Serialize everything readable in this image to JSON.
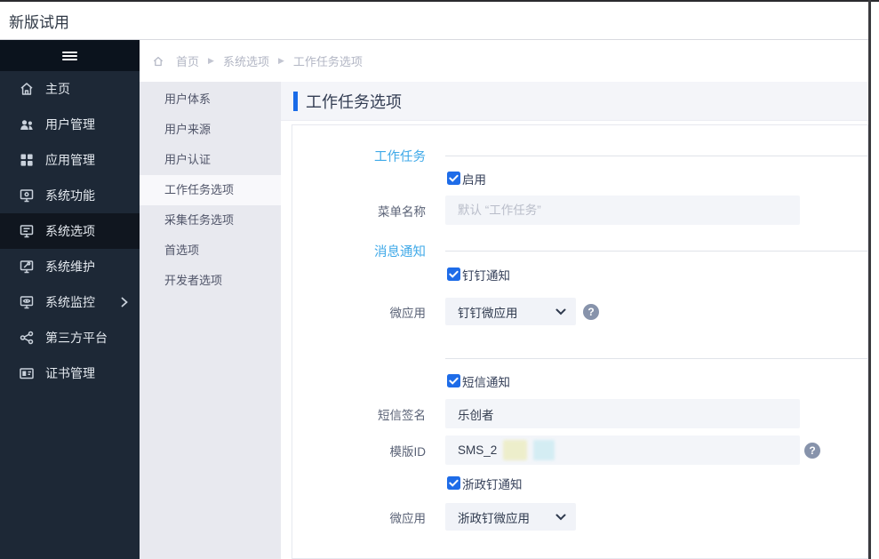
{
  "colors": {
    "accent_blue": "#1a6be8",
    "section_title_blue": "#3fa9e8",
    "checkbox_blue": "#1e6ce8",
    "sidebar_bg": "#1d2836",
    "sidebar_active_bg": "#10161f",
    "submenu_bg": "#e8e9ef",
    "titlebar_bg": "#f4f5f9",
    "input_bg": "#f3f5f9"
  },
  "header": {
    "app_title": "新版试用"
  },
  "sidebar": {
    "items": [
      {
        "label": "主页"
      },
      {
        "label": "用户管理"
      },
      {
        "label": "应用管理"
      },
      {
        "label": "系统功能"
      },
      {
        "label": "系统选项"
      },
      {
        "label": "系统维护"
      },
      {
        "label": "系统监控"
      },
      {
        "label": "第三方平台"
      },
      {
        "label": "证书管理"
      }
    ]
  },
  "breadcrumb": {
    "separator": "▶",
    "items": [
      "首页",
      "系统选项",
      "工作任务选项"
    ]
  },
  "submenu": {
    "items": [
      {
        "label": "用户体系"
      },
      {
        "label": "用户来源"
      },
      {
        "label": "用户认证"
      },
      {
        "label": "工作任务选项"
      },
      {
        "label": "采集任务选项"
      },
      {
        "label": "首选项"
      },
      {
        "label": "开发者选项"
      }
    ]
  },
  "page": {
    "title": "工作任务选项"
  },
  "form": {
    "section_work": {
      "title": "工作任务"
    },
    "enable": {
      "label": "启用",
      "checked": true
    },
    "menu_name": {
      "label": "菜单名称",
      "placeholder": "默认 “工作任务”",
      "value": ""
    },
    "section_notify": {
      "title": "消息通知"
    },
    "dingtalk": {
      "label": "钉钉通知",
      "checked": true
    },
    "dingtalk_app": {
      "label": "微应用",
      "value": "钉钉微应用"
    },
    "sms": {
      "label": "短信通知",
      "checked": true
    },
    "sms_sign": {
      "label": "短信签名",
      "value": "乐创者"
    },
    "sms_template": {
      "label": "模版ID",
      "value": "SMS_2"
    },
    "zzd": {
      "label": "浙政钉通知",
      "checked": true
    },
    "zzd_app": {
      "label": "微应用",
      "value": "浙政钉微应用"
    }
  },
  "icons": {
    "help_glyph": "?"
  }
}
